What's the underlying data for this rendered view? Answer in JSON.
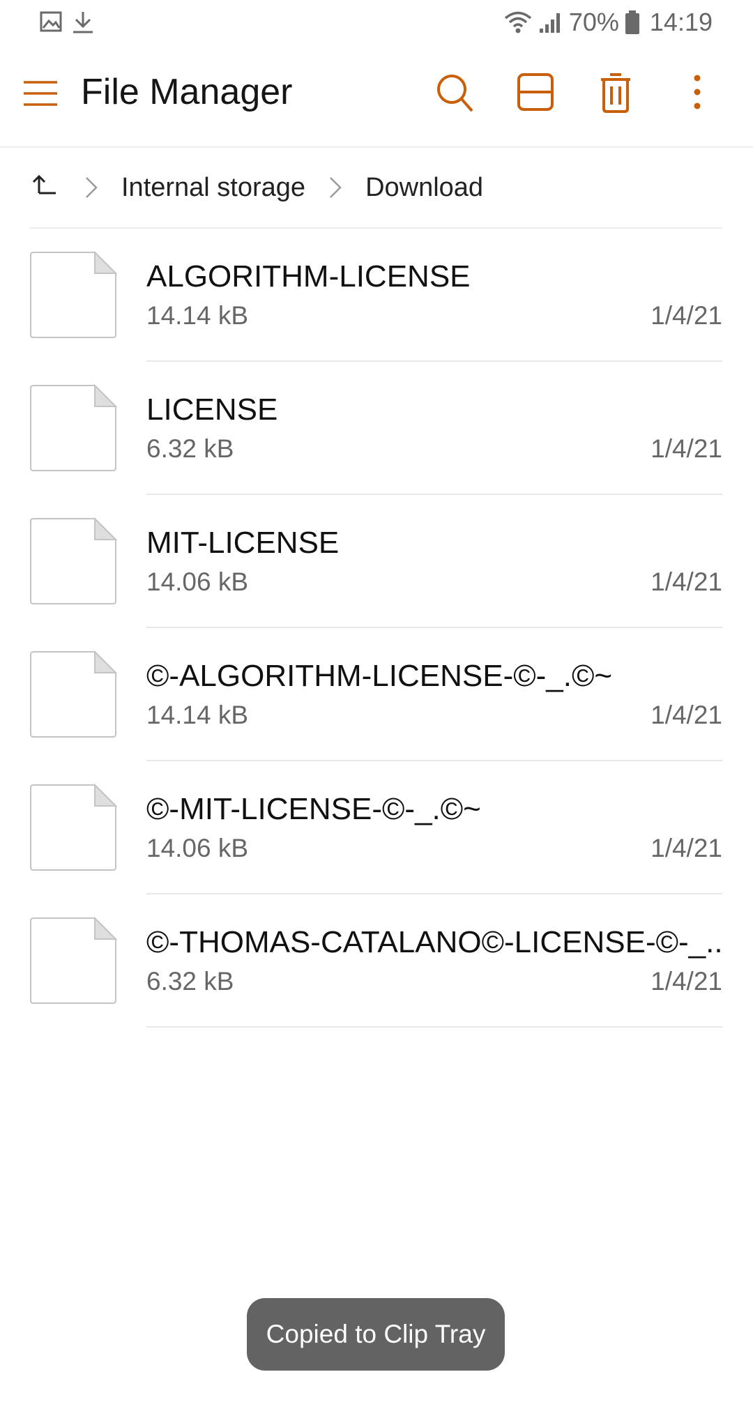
{
  "status_bar": {
    "left_icons": [
      "image-notification-icon",
      "download-notification-icon"
    ],
    "wifi_icon": "wifi-icon",
    "signal_icon": "signal-icon",
    "battery_percent": "70%",
    "battery_icon": "battery-icon",
    "time": "14:19"
  },
  "app_bar": {
    "title": "File Manager",
    "menu_icon": "hamburger-menu-icon",
    "actions": [
      "search-icon",
      "view-layout-icon",
      "delete-icon",
      "more-vert-icon"
    ],
    "accent_color": "#C8600A"
  },
  "breadcrumb": {
    "up_icon": "up-arrow-icon",
    "items": [
      "Internal storage",
      "Download"
    ]
  },
  "files": [
    {
      "name": "ALGORITHM-LICENSE",
      "size": "14.14 kB",
      "date": "1/4/21"
    },
    {
      "name": "LICENSE",
      "size": "6.32 kB",
      "date": "1/4/21"
    },
    {
      "name": "MIT-LICENSE",
      "size": "14.06 kB",
      "date": "1/4/21"
    },
    {
      "name": "©-ALGORITHM-LICENSE-©-_.©~",
      "size": "14.14 kB",
      "date": "1/4/21"
    },
    {
      "name": "©-MIT-LICENSE-©-_.©~",
      "size": "14.06 kB",
      "date": "1/4/21"
    },
    {
      "name": "©-THOMAS-CATALANO©-LICENSE-©-_..",
      "size": "6.32 kB",
      "date": "1/4/21"
    }
  ],
  "toast": {
    "text": "Copied to Clip Tray"
  }
}
